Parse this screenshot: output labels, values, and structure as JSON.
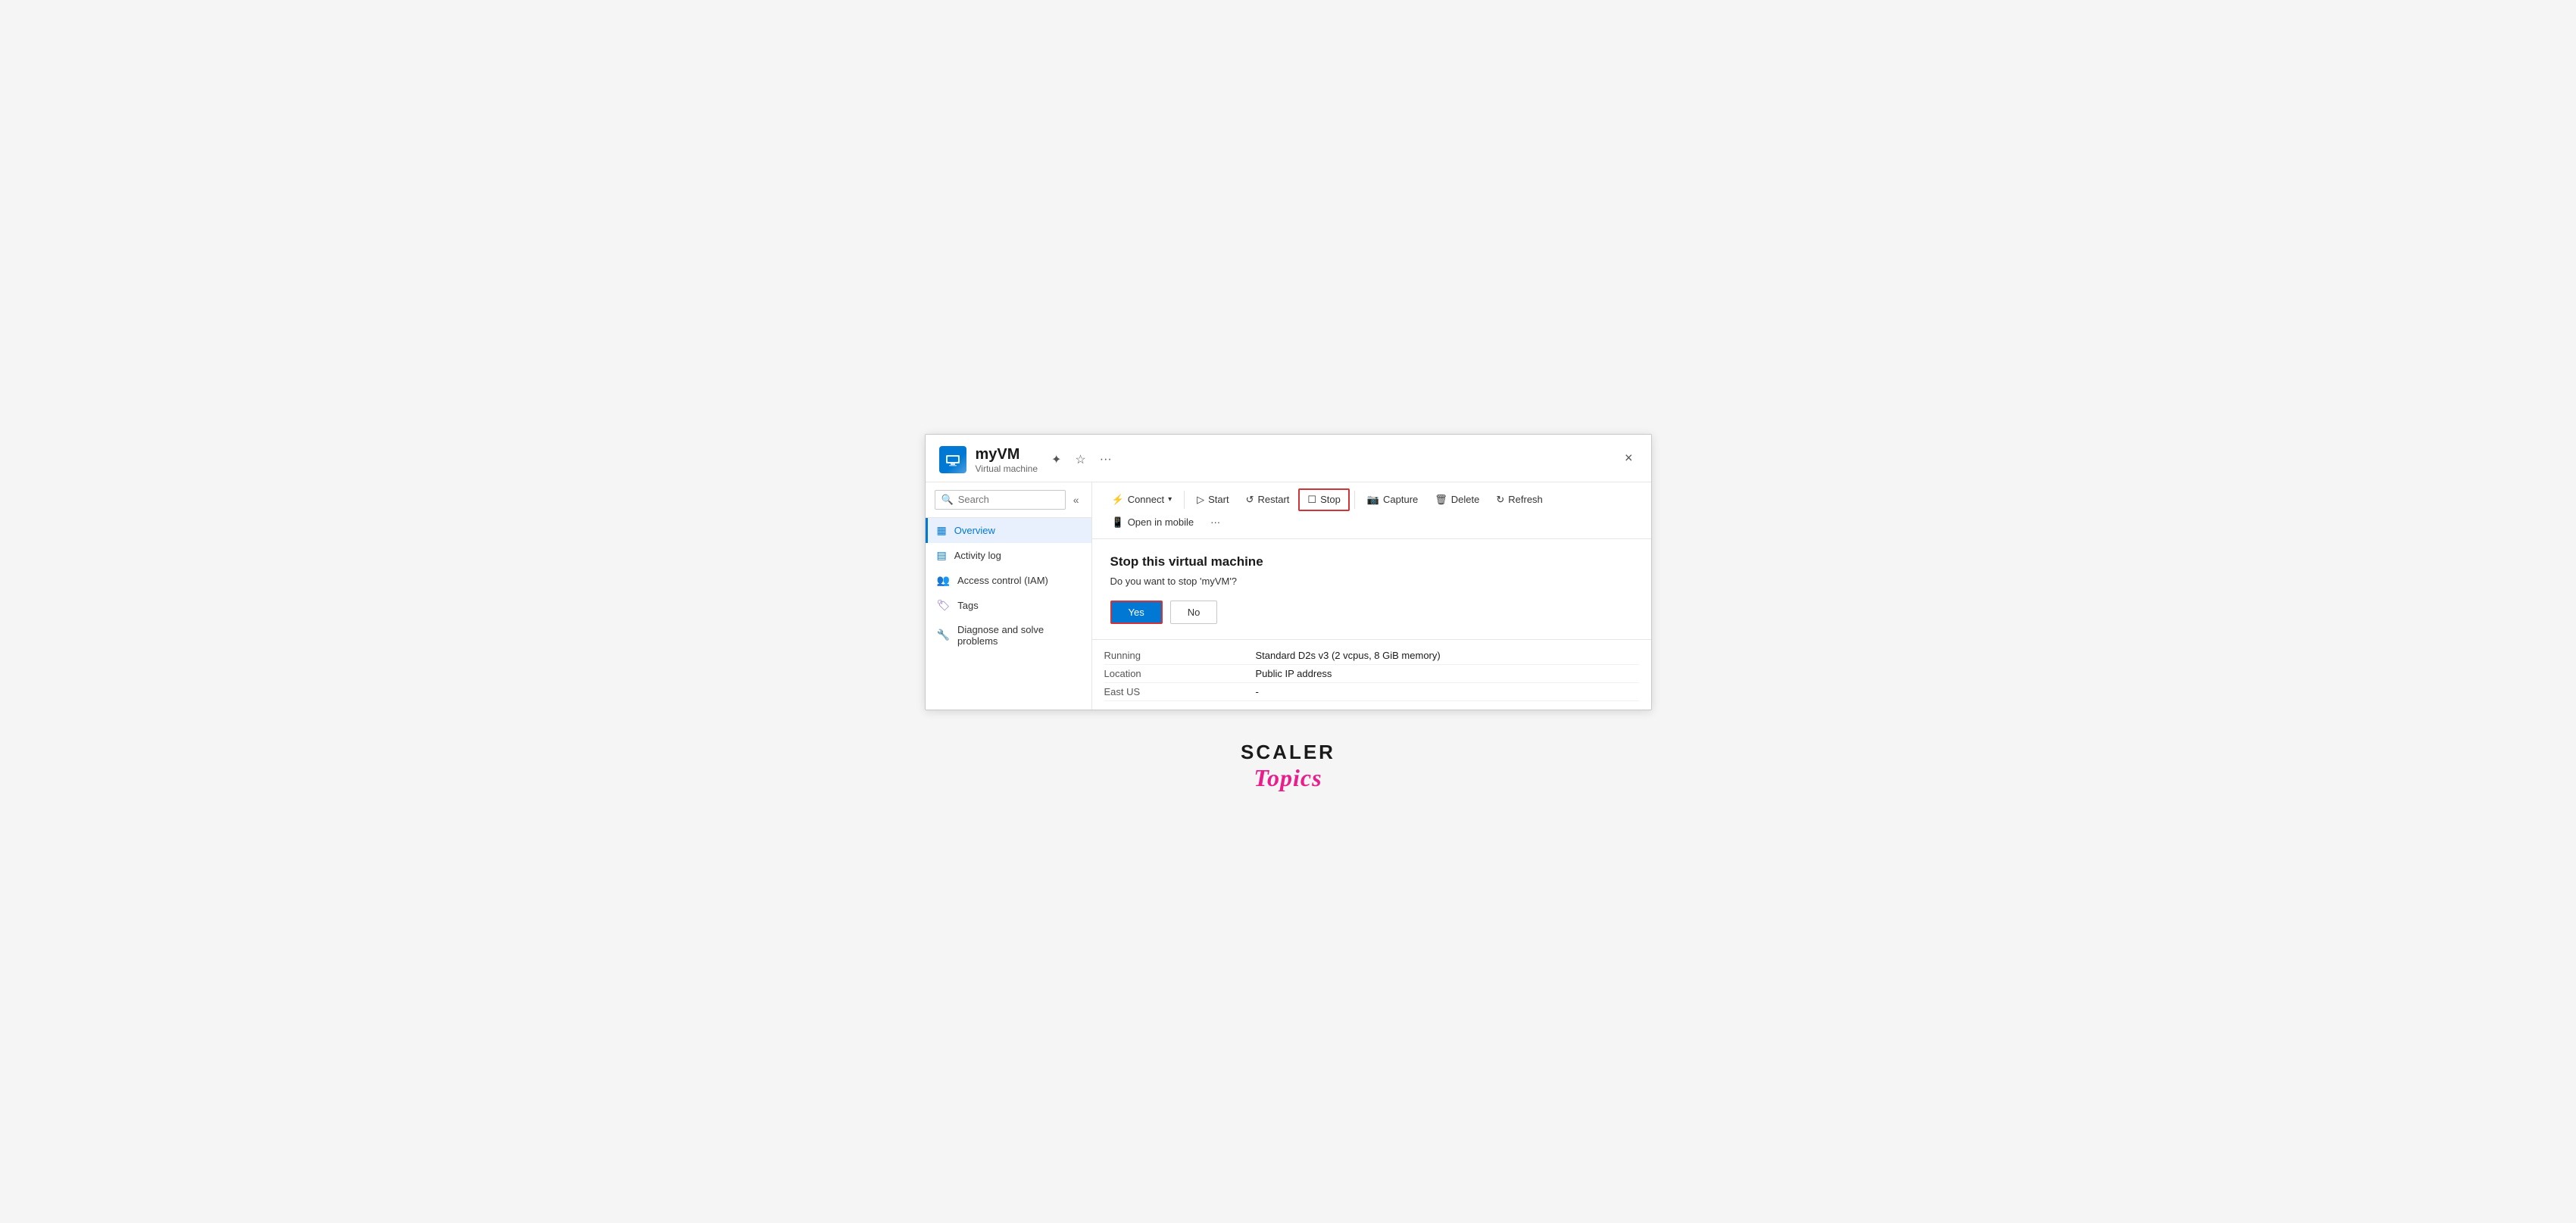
{
  "window": {
    "title": "myVM",
    "subtitle": "Virtual machine",
    "close_label": "×"
  },
  "title_icons": {
    "pin": "☆",
    "star": "★",
    "more": "···"
  },
  "search": {
    "placeholder": "Search",
    "collapse": "«"
  },
  "nav": {
    "items": [
      {
        "id": "overview",
        "label": "Overview",
        "icon": "▦",
        "icon_class": "blue",
        "active": true
      },
      {
        "id": "activity-log",
        "label": "Activity log",
        "icon": "▤",
        "icon_class": "blue"
      },
      {
        "id": "access-control",
        "label": "Access control (IAM)",
        "icon": "👥",
        "icon_class": "blue"
      },
      {
        "id": "tags",
        "label": "Tags",
        "icon": "🏷",
        "icon_class": "purple"
      },
      {
        "id": "diagnose",
        "label": "Diagnose and solve problems",
        "icon": "🔧",
        "icon_class": "gray"
      }
    ]
  },
  "toolbar": {
    "connect_label": "Connect",
    "start_label": "Start",
    "restart_label": "Restart",
    "stop_label": "Stop",
    "capture_label": "Capture",
    "delete_label": "Delete",
    "refresh_label": "Refresh",
    "open_mobile_label": "Open in mobile",
    "more_label": "···"
  },
  "dialog": {
    "title": "Stop this virtual machine",
    "message": "Do you want to stop 'myVM'?",
    "yes_label": "Yes",
    "no_label": "No"
  },
  "info": {
    "rows": [
      {
        "label": "Running",
        "value": "Standard D2s v3 (2 vcpus, 8 GiB memory)"
      },
      {
        "label": "Location",
        "value": "Public IP address"
      },
      {
        "label": "East US",
        "value": "-"
      }
    ]
  },
  "branding": {
    "scaler": "SCALER",
    "topics": "Topics"
  }
}
